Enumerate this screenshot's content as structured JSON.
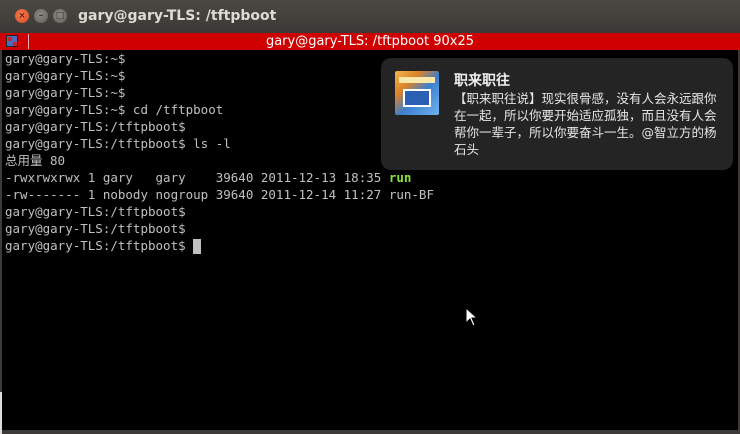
{
  "window": {
    "title": "gary@gary-TLS: /tftpboot"
  },
  "terminal": {
    "title": "gary@gary-TLS: /tftpboot 90x25",
    "lines": [
      "gary@gary-TLS:~$",
      "gary@gary-TLS:~$",
      "gary@gary-TLS:~$",
      "gary@gary-TLS:~$ cd /tftpboot",
      "gary@gary-TLS:/tftpboot$",
      "gary@gary-TLS:/tftpboot$ ls -l",
      "总用量 80"
    ],
    "ls_rows": [
      {
        "prefix": "-rwxrwxrwx 1 gary   gary    39640 2011-12-13 18:35 ",
        "name": "run",
        "exec": true
      },
      {
        "prefix": "-rw------- 1 nobody nogroup 39640 2011-12-14 11:27 ",
        "name": "run-BF",
        "exec": false
      }
    ],
    "tail_lines": [
      "gary@gary-TLS:/tftpboot$",
      "gary@gary-TLS:/tftpboot$",
      "gary@gary-TLS:/tftpboot$ "
    ],
    "colors": {
      "background": "#000000",
      "text": "#c0c0c0",
      "executable": "#8ae234",
      "titlebar": "#ce0000"
    }
  },
  "notification": {
    "title": "职来职往",
    "body": "【职来职往说】现实很骨感，没有人会永远跟你在一起，所以你要开始适应孤独，而且没有人会帮你一辈子，所以你要奋斗一生。@智立方的杨石头",
    "icon": "tv-show-thumbnail"
  }
}
